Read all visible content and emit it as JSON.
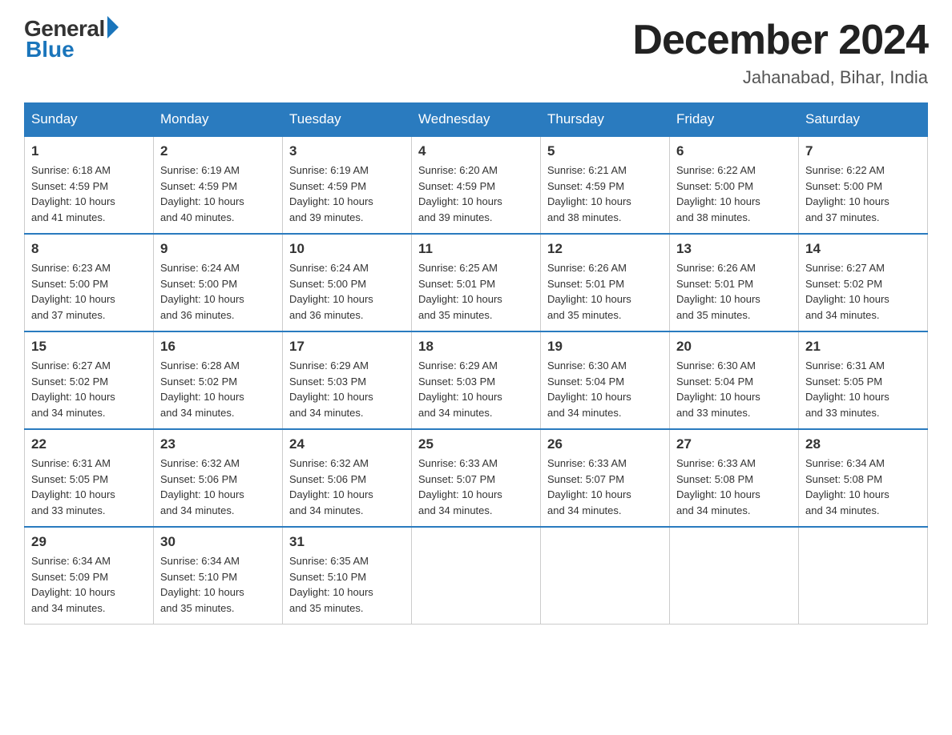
{
  "header": {
    "logo_general": "General",
    "logo_blue": "Blue",
    "title": "December 2024",
    "subtitle": "Jahanabad, Bihar, India"
  },
  "days_of_week": [
    "Sunday",
    "Monday",
    "Tuesday",
    "Wednesday",
    "Thursday",
    "Friday",
    "Saturday"
  ],
  "weeks": [
    [
      {
        "day": "1",
        "sunrise": "6:18 AM",
        "sunset": "4:59 PM",
        "daylight": "10 hours and 41 minutes."
      },
      {
        "day": "2",
        "sunrise": "6:19 AM",
        "sunset": "4:59 PM",
        "daylight": "10 hours and 40 minutes."
      },
      {
        "day": "3",
        "sunrise": "6:19 AM",
        "sunset": "4:59 PM",
        "daylight": "10 hours and 39 minutes."
      },
      {
        "day": "4",
        "sunrise": "6:20 AM",
        "sunset": "4:59 PM",
        "daylight": "10 hours and 39 minutes."
      },
      {
        "day": "5",
        "sunrise": "6:21 AM",
        "sunset": "4:59 PM",
        "daylight": "10 hours and 38 minutes."
      },
      {
        "day": "6",
        "sunrise": "6:22 AM",
        "sunset": "5:00 PM",
        "daylight": "10 hours and 38 minutes."
      },
      {
        "day": "7",
        "sunrise": "6:22 AM",
        "sunset": "5:00 PM",
        "daylight": "10 hours and 37 minutes."
      }
    ],
    [
      {
        "day": "8",
        "sunrise": "6:23 AM",
        "sunset": "5:00 PM",
        "daylight": "10 hours and 37 minutes."
      },
      {
        "day": "9",
        "sunrise": "6:24 AM",
        "sunset": "5:00 PM",
        "daylight": "10 hours and 36 minutes."
      },
      {
        "day": "10",
        "sunrise": "6:24 AM",
        "sunset": "5:00 PM",
        "daylight": "10 hours and 36 minutes."
      },
      {
        "day": "11",
        "sunrise": "6:25 AM",
        "sunset": "5:01 PM",
        "daylight": "10 hours and 35 minutes."
      },
      {
        "day": "12",
        "sunrise": "6:26 AM",
        "sunset": "5:01 PM",
        "daylight": "10 hours and 35 minutes."
      },
      {
        "day": "13",
        "sunrise": "6:26 AM",
        "sunset": "5:01 PM",
        "daylight": "10 hours and 35 minutes."
      },
      {
        "day": "14",
        "sunrise": "6:27 AM",
        "sunset": "5:02 PM",
        "daylight": "10 hours and 34 minutes."
      }
    ],
    [
      {
        "day": "15",
        "sunrise": "6:27 AM",
        "sunset": "5:02 PM",
        "daylight": "10 hours and 34 minutes."
      },
      {
        "day": "16",
        "sunrise": "6:28 AM",
        "sunset": "5:02 PM",
        "daylight": "10 hours and 34 minutes."
      },
      {
        "day": "17",
        "sunrise": "6:29 AM",
        "sunset": "5:03 PM",
        "daylight": "10 hours and 34 minutes."
      },
      {
        "day": "18",
        "sunrise": "6:29 AM",
        "sunset": "5:03 PM",
        "daylight": "10 hours and 34 minutes."
      },
      {
        "day": "19",
        "sunrise": "6:30 AM",
        "sunset": "5:04 PM",
        "daylight": "10 hours and 34 minutes."
      },
      {
        "day": "20",
        "sunrise": "6:30 AM",
        "sunset": "5:04 PM",
        "daylight": "10 hours and 33 minutes."
      },
      {
        "day": "21",
        "sunrise": "6:31 AM",
        "sunset": "5:05 PM",
        "daylight": "10 hours and 33 minutes."
      }
    ],
    [
      {
        "day": "22",
        "sunrise": "6:31 AM",
        "sunset": "5:05 PM",
        "daylight": "10 hours and 33 minutes."
      },
      {
        "day": "23",
        "sunrise": "6:32 AM",
        "sunset": "5:06 PM",
        "daylight": "10 hours and 34 minutes."
      },
      {
        "day": "24",
        "sunrise": "6:32 AM",
        "sunset": "5:06 PM",
        "daylight": "10 hours and 34 minutes."
      },
      {
        "day": "25",
        "sunrise": "6:33 AM",
        "sunset": "5:07 PM",
        "daylight": "10 hours and 34 minutes."
      },
      {
        "day": "26",
        "sunrise": "6:33 AM",
        "sunset": "5:07 PM",
        "daylight": "10 hours and 34 minutes."
      },
      {
        "day": "27",
        "sunrise": "6:33 AM",
        "sunset": "5:08 PM",
        "daylight": "10 hours and 34 minutes."
      },
      {
        "day": "28",
        "sunrise": "6:34 AM",
        "sunset": "5:08 PM",
        "daylight": "10 hours and 34 minutes."
      }
    ],
    [
      {
        "day": "29",
        "sunrise": "6:34 AM",
        "sunset": "5:09 PM",
        "daylight": "10 hours and 34 minutes."
      },
      {
        "day": "30",
        "sunrise": "6:34 AM",
        "sunset": "5:10 PM",
        "daylight": "10 hours and 35 minutes."
      },
      {
        "day": "31",
        "sunrise": "6:35 AM",
        "sunset": "5:10 PM",
        "daylight": "10 hours and 35 minutes."
      },
      null,
      null,
      null,
      null
    ]
  ],
  "labels": {
    "sunrise": "Sunrise:",
    "sunset": "Sunset:",
    "daylight": "Daylight:"
  }
}
